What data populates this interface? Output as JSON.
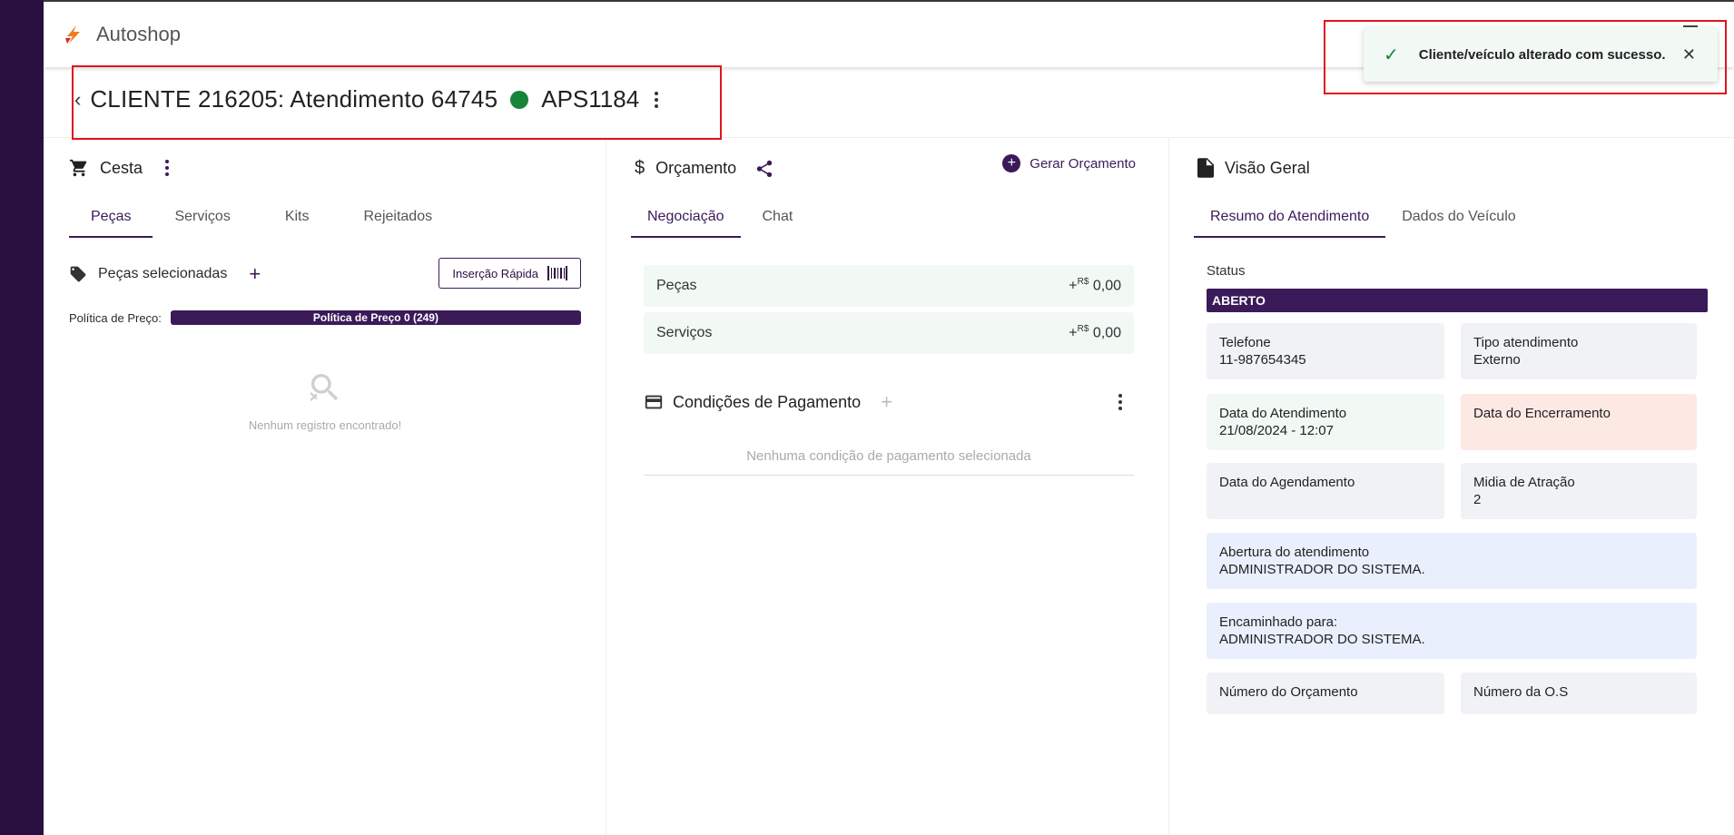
{
  "app": {
    "title": "Autoshop"
  },
  "header": {
    "back": "‹",
    "title": "CLIENTE 216205: Atendimento 64745",
    "plate": "APS1184",
    "status_color": "#17843b"
  },
  "toast": {
    "message": "Cliente/veículo alterado com sucesso.",
    "close": "✕",
    "check": "✓"
  },
  "cesta": {
    "title": "Cesta",
    "tabs": [
      "Peças",
      "Serviços",
      "Kits",
      "Rejeitados"
    ],
    "selected_title": "Peças selecionadas",
    "add": "+",
    "quick_insert": "Inserção Rápida",
    "policy_label": "Política de Preço:",
    "policy_value": "Política de Preço 0 (249)",
    "empty": "Nenhum registro encontrado!"
  },
  "orcamento": {
    "title": "Orçamento",
    "generate": "Gerar Orçamento",
    "tabs": [
      "Negociação",
      "Chat"
    ],
    "rows": [
      {
        "label": "Peças",
        "sign": "+",
        "currency": "R$",
        "value": "0,00"
      },
      {
        "label": "Serviços",
        "sign": "+",
        "currency": "R$",
        "value": "0,00"
      }
    ],
    "conditions_title": "Condições de Pagamento",
    "conditions_add": "+",
    "conditions_empty": "Nenhuma condição de pagamento selecionada"
  },
  "visao": {
    "title": "Visão Geral",
    "tabs": [
      "Resumo do Atendimento",
      "Dados do Veículo"
    ],
    "status_label": "Status",
    "status_value": "ABERTO",
    "cards": {
      "telefone": {
        "label": "Telefone",
        "value": "11-987654345"
      },
      "tipo": {
        "label": "Tipo atendimento",
        "value": "Externo"
      },
      "data_atend": {
        "label": "Data do Atendimento",
        "value": "21/08/2024 - 12:07"
      },
      "data_enc": {
        "label": "Data do Encerramento",
        "value": ""
      },
      "data_agend": {
        "label": "Data do Agendamento",
        "value": ""
      },
      "midia": {
        "label": "Midia de Atração",
        "value": "2"
      },
      "abertura": {
        "label": "Abertura do atendimento",
        "value": "ADMINISTRADOR DO SISTEMA."
      },
      "encaminhado": {
        "label": "Encaminhado para:",
        "value": "ADMINISTRADOR DO SISTEMA."
      },
      "num_orc": {
        "label": "Número do Orçamento",
        "value": ""
      },
      "num_os": {
        "label": "Número da O.S",
        "value": ""
      }
    }
  },
  "colors": {
    "primary": "#3b1a5a",
    "sidebar": "#2a1040",
    "highlight": "#e0141e"
  }
}
